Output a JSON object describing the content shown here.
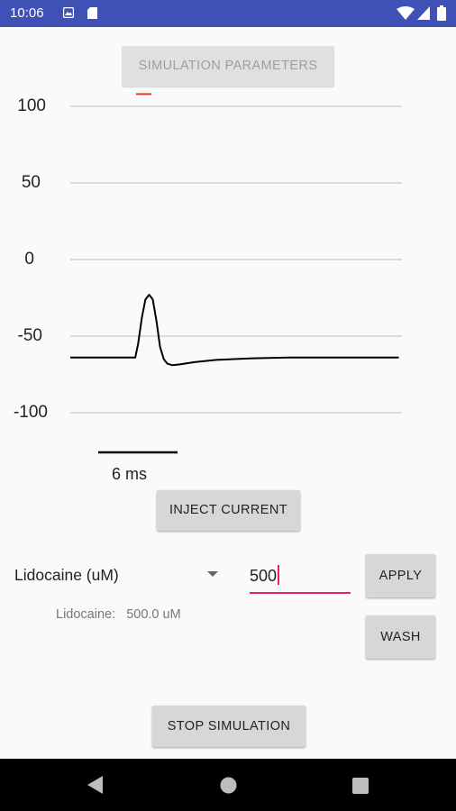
{
  "status_bar": {
    "time": "10:06",
    "left_icons": [
      "image-notification-icon",
      "sd-card-icon"
    ],
    "right_icons": [
      "wifi-icon",
      "signal-icon",
      "battery-icon"
    ],
    "background": "#3f51b5"
  },
  "buttons": {
    "simulation_parameters": "SIMULATION PARAMETERS",
    "inject_current": "INJECT CURRENT",
    "apply": "APPLY",
    "wash": "WASH",
    "stop_simulation": "STOP SIMULATION"
  },
  "chart_data": {
    "type": "line",
    "y_ticks": [
      "100",
      "50",
      "0",
      "-50",
      "-100"
    ],
    "ylim": [
      -100,
      100
    ],
    "grid": true,
    "scale_bar_label": "6 ms",
    "series": [
      {
        "color": "#000000",
        "x_ms": [
          0,
          8.9,
          9.3,
          9.8,
          10.3,
          10.8,
          11.3,
          11.8,
          12.3,
          12.8,
          13.3,
          14,
          15,
          17,
          20,
          25,
          30,
          36,
          45
        ],
        "y": [
          -64,
          -64,
          -55,
          -38,
          -26,
          -23,
          -26,
          -40,
          -57,
          -65,
          -68,
          -69,
          -68.5,
          -67,
          -65.5,
          -64.5,
          -64,
          -64,
          -64
        ]
      }
    ],
    "marker": {
      "color": "#e53935",
      "value": 108
    }
  },
  "drug": {
    "selected": "Lidocaine (uM)",
    "input_value": "500",
    "status_label": "Lidocaine:",
    "status_value": "500.0 uM"
  },
  "nav": {
    "icons": [
      "back-icon",
      "home-icon",
      "recents-icon"
    ]
  }
}
